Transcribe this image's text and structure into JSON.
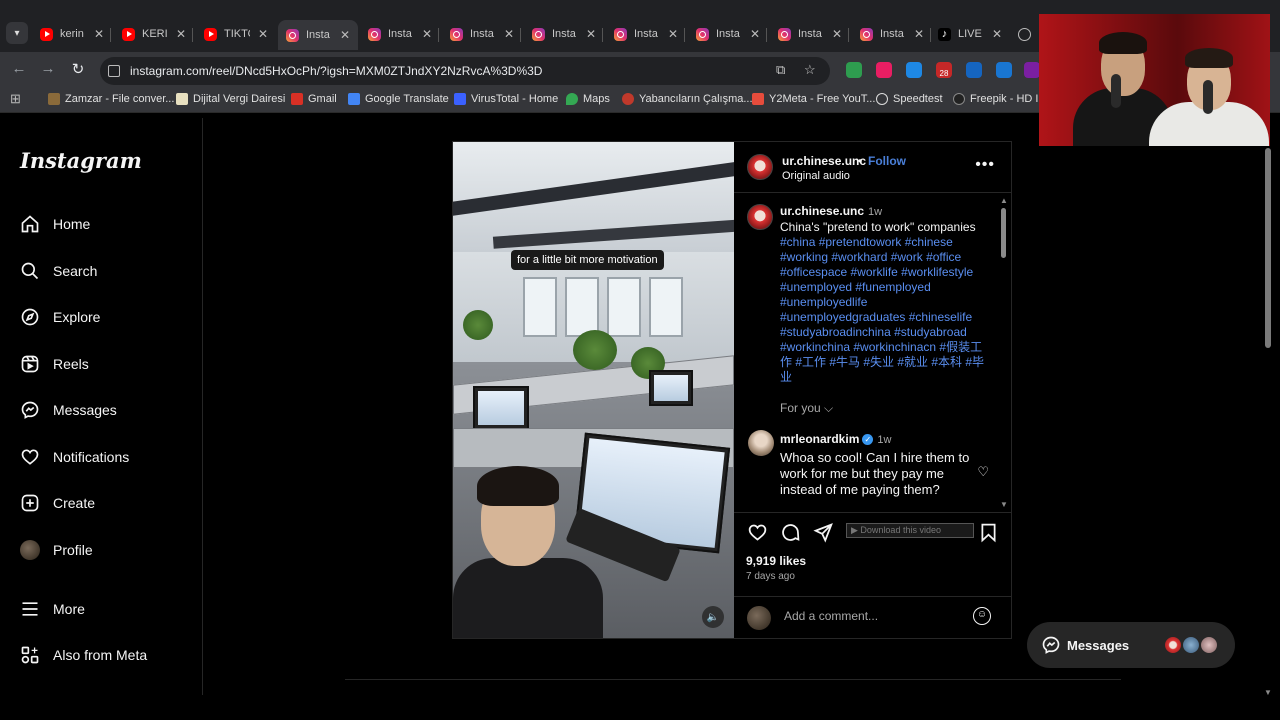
{
  "browser": {
    "tabs": [
      {
        "label": "kerin",
        "kind": "yt"
      },
      {
        "label": "KERII",
        "kind": "yt"
      },
      {
        "label": "TIKTO",
        "kind": "yt"
      },
      {
        "label": "Insta",
        "kind": "ig",
        "active": true
      },
      {
        "label": "Insta",
        "kind": "ig"
      },
      {
        "label": "Insta",
        "kind": "ig"
      },
      {
        "label": "Insta",
        "kind": "ig"
      },
      {
        "label": "Insta",
        "kind": "ig"
      },
      {
        "label": "Insta",
        "kind": "ig"
      },
      {
        "label": "Insta",
        "kind": "ig"
      },
      {
        "label": "Insta",
        "kind": "ig"
      },
      {
        "label": "LIVE",
        "kind": "tt"
      }
    ],
    "url": "instagram.com/reel/DNcd5HxOcPh/?igsh=MXM0ZTJndXY2NzRvcA%3D%3D",
    "extension_badge": "28",
    "bookmarks": [
      {
        "label": "Zamzar - File conver...",
        "color": "#8a6a3a"
      },
      {
        "label": "Dijital Vergi Dairesi",
        "color": "#e8e0c0"
      },
      {
        "label": "Gmail",
        "color": "#d93025"
      },
      {
        "label": "Google Translate",
        "color": "#4285f4"
      },
      {
        "label": "VirusTotal - Home",
        "color": "#3b61ff"
      },
      {
        "label": "Maps",
        "color": "#34a853"
      },
      {
        "label": "Yabancıların Çalışma...",
        "color": "#c0392b"
      },
      {
        "label": "Y2Meta - Free YouT...",
        "color": "#e74c3c"
      },
      {
        "label": "Speedtest",
        "color": "#dddddd"
      },
      {
        "label": "Freepik - HD Im",
        "color": "#222222"
      }
    ]
  },
  "sidebar": {
    "logo": "Instagram",
    "items": [
      {
        "label": "Home",
        "icon": "home-icon"
      },
      {
        "label": "Search",
        "icon": "search-icon"
      },
      {
        "label": "Explore",
        "icon": "explore-icon"
      },
      {
        "label": "Reels",
        "icon": "reels-icon"
      },
      {
        "label": "Messages",
        "icon": "messenger-icon"
      },
      {
        "label": "Notifications",
        "icon": "heart-icon"
      },
      {
        "label": "Create",
        "icon": "plus-square-icon"
      },
      {
        "label": "Profile",
        "icon": "avatar"
      },
      {
        "label": "More",
        "icon": "hamburger-icon"
      },
      {
        "label": "Also from Meta",
        "icon": "meta-grid-icon"
      }
    ]
  },
  "post": {
    "video_caption": "for a little bit more motivation",
    "author": "ur.chinese.unc",
    "follow": "Follow",
    "separator": "•",
    "audio": "Original audio",
    "caption_author": "ur.chinese.unc",
    "caption_time": "1w",
    "caption_text": "China's \"pretend to work\" companies",
    "caption_tags": "#china #pretendtowork #chinese #working #workhard #work #office #officespace #worklife #worklifestyle #unemployed #funemployed #unemployedlife #unemployedgraduates #chineselife #studyabroadinchina #studyabroad #workinchina #workinchinacn #假装工作 #工作 #牛马 #失业 #就业 #本科 #毕业",
    "for_you": "For you",
    "comment": {
      "user": "mrleonardkim",
      "time": "1w",
      "text": "Whoa so cool! Can I hire them to work for me but they pay me instead of me paying them?"
    },
    "download_label": "Download this video",
    "likes": "9,919 likes",
    "ago": "7 days ago",
    "add_comment_placeholder": "Add a comment..."
  },
  "messages_pill": {
    "label": "Messages"
  },
  "colors": {
    "link": "#4a7fd8",
    "hashtag": "#5a8ef0",
    "verified": "#3897f0"
  }
}
